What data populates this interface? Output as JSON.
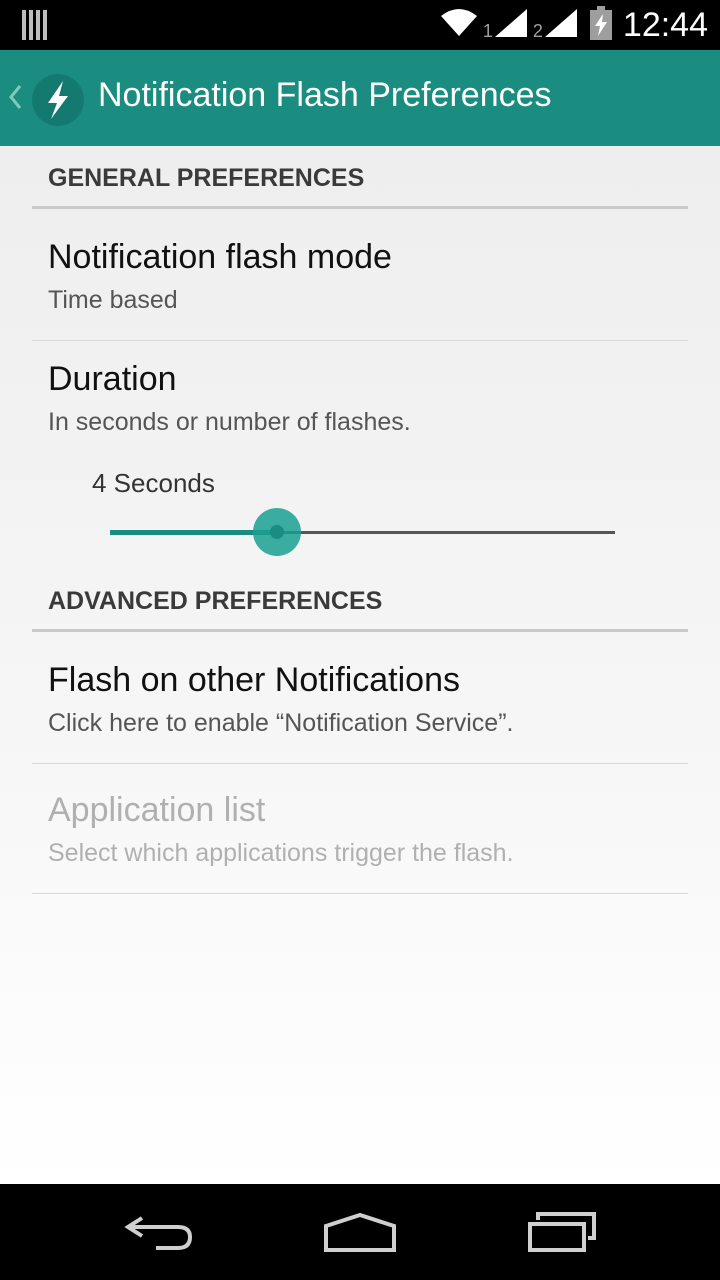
{
  "status_bar": {
    "time": "12:44",
    "sim1": "1",
    "sim2": "2",
    "icons": [
      "notification-bars-icon",
      "wifi-icon",
      "signal-icon",
      "battery-charging-icon"
    ]
  },
  "action_bar": {
    "title": "Notification Flash Preferences",
    "icon": "flash-icon",
    "color": "#1a8c80"
  },
  "sections": {
    "general": {
      "header": "GENERAL PREFERENCES",
      "flash_mode": {
        "title": "Notification flash mode",
        "summary": "Time based"
      },
      "duration": {
        "title": "Duration",
        "summary": "In seconds or number of flashes.",
        "seek_label": "4 Seconds",
        "seek_fraction": 0.33
      }
    },
    "advanced": {
      "header": "ADVANCED PREFERENCES",
      "flash_other": {
        "title": "Flash on other Notifications",
        "summary": "Click here to enable “Notification Service”."
      },
      "app_list": {
        "title": "Application list",
        "summary": "Select which applications trigger the flash.",
        "enabled": false
      }
    }
  },
  "nav_bar": {
    "buttons": [
      "back-icon",
      "home-icon",
      "recents-icon"
    ]
  }
}
